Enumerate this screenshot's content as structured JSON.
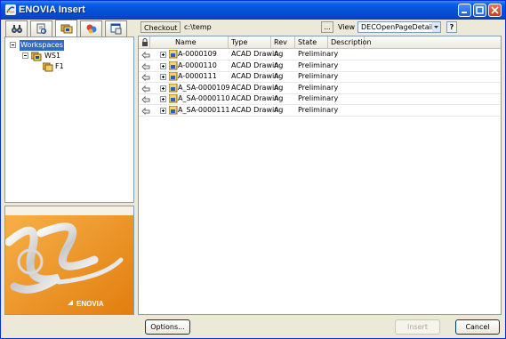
{
  "window": {
    "title": "ENOVIA Insert"
  },
  "left_tabs": [
    {
      "icon": "binoculars-icon"
    },
    {
      "icon": "document-search-icon"
    },
    {
      "icon": "workspace-icon"
    },
    {
      "icon": "collaboration-icon"
    },
    {
      "icon": "window-icon"
    }
  ],
  "tree": {
    "root": "Workspaces",
    "child": "WS1",
    "grandchild": "F1"
  },
  "brand": {
    "logo_text": "ENOVIA",
    "accent": "#f39c1f"
  },
  "toolbar": {
    "checkout_label": "Checkout To",
    "checkout_path": "c:\\temp",
    "browse_label": "...",
    "view_label": "View",
    "view_value": "DECOpenPageDetails",
    "help_label": "?"
  },
  "grid": {
    "columns": [
      "Name",
      "Type",
      "Rev",
      "State",
      "Description"
    ],
    "rows": [
      {
        "name": "A-0000109",
        "type": "ACAD Drawing",
        "rev": "A",
        "state": "Preliminary",
        "description": ""
      },
      {
        "name": "A-0000110",
        "type": "ACAD Drawing",
        "rev": "A",
        "state": "Preliminary",
        "description": ""
      },
      {
        "name": "A-0000111",
        "type": "ACAD Drawing",
        "rev": "A",
        "state": "Preliminary",
        "description": ""
      },
      {
        "name": "A_SA-0000109",
        "type": "ACAD Drawing",
        "rev": "A",
        "state": "Preliminary",
        "description": ""
      },
      {
        "name": "A_SA-0000110",
        "type": "ACAD Drawing",
        "rev": "A",
        "state": "Preliminary",
        "description": ""
      },
      {
        "name": "A_SA-0000111",
        "type": "ACAD Drawing",
        "rev": "A",
        "state": "Preliminary",
        "description": ""
      }
    ]
  },
  "buttons": {
    "options": "Options...",
    "insert": "Insert",
    "cancel": "Cancel"
  }
}
